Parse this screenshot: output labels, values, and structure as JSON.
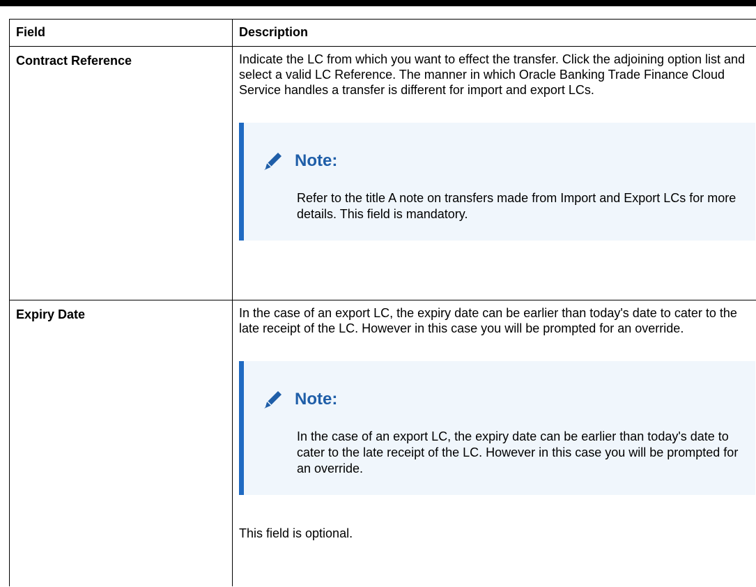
{
  "table": {
    "headers": [
      "Field",
      "Description"
    ],
    "rows": [
      {
        "field": "Contract Reference",
        "description": "Indicate the LC from which you want to effect the transfer. Click the adjoining option list and select a valid LC Reference. The manner in which Oracle Banking Trade Finance Cloud Service handles a transfer is different for import and export LCs.",
        "note_title": "Note:",
        "note_text": "Refer to the title A note on transfers made from Import and Export LCs for more details. This field is mandatory."
      },
      {
        "field": "Expiry Date",
        "description": "In the case of an export LC, the expiry date can be earlier than today's date to cater to the late receipt of the LC. However in this case you will be prompted for an override.",
        "note_title": "Note:",
        "note_text": "In the case of an export LC, the expiry date can be earlier than today's date to cater to the late receipt of the LC. However in this case you will be prompted for an override.",
        "after_note": "This field is optional."
      }
    ]
  },
  "colors": {
    "note_accent": "#1f6ac2",
    "note_background": "#f0f6fc",
    "note_title": "#1f5ea8"
  },
  "icons": {
    "note": "pencil-icon"
  }
}
